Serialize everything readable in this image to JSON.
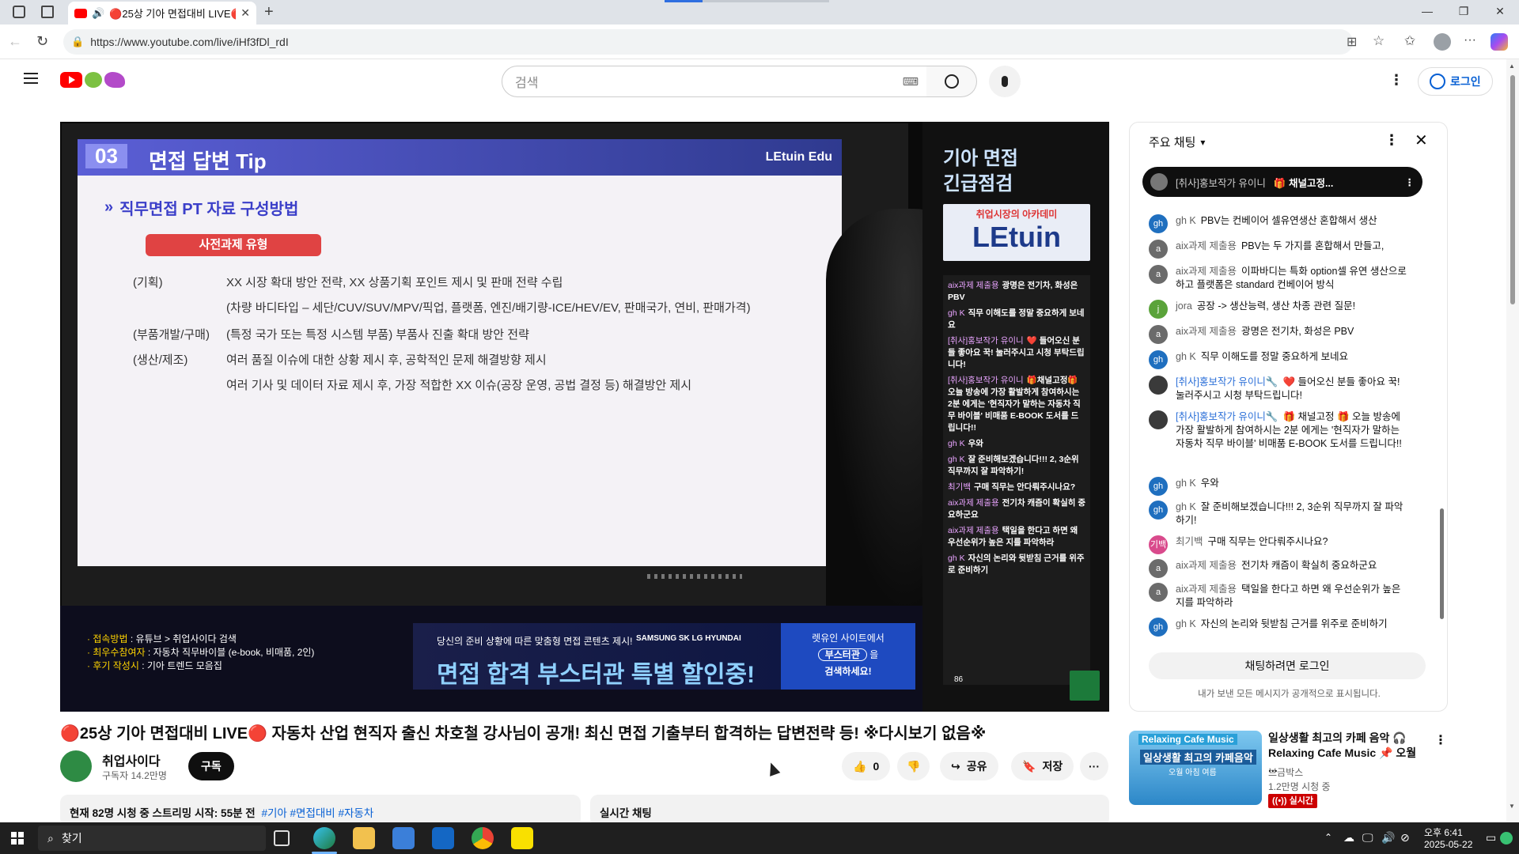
{
  "browser": {
    "tab_title": "🔴25상 기아 면접대비 LIVE🔴",
    "url": "https://www.youtube.com/live/iHf3fDl_rdI"
  },
  "youtube": {
    "search_placeholder": "검색",
    "login_label": "로그인"
  },
  "slide": {
    "section_number": "03",
    "section_title": "면접 답변 Tip",
    "brand": "LEtuin Edu",
    "subtitle": "직무면접 PT 자료 구성방법",
    "badge": "사전과제 유형",
    "rows": [
      {
        "label": "(기획)",
        "text": "XX 시장 확대 방안 전략, XX 상품기획 포인트 제시 및 판매 전략 수립"
      },
      {
        "label": "",
        "text": "(차량 바디타입 – 세단/CUV/SUV/MPV/픽업, 플랫폼, 엔진/배기량-ICE/HEV/EV, 판매국가, 연비, 판매가격)"
      },
      {
        "label": "(부품개발/구매)",
        "text": "(특정 국가 또는 특정 시스템 부품) 부품사 진출 확대 방안 전략"
      },
      {
        "label": "(생산/제조)",
        "text": "여러 품질 이슈에 대한 상황 제시 후, 공학적인 문제 해결방향 제시"
      },
      {
        "label": "",
        "text": "여러 기사 및 데이터 자료 제시 후, 가장 적합한 XX 이슈(공장 운영, 공법 결정 등) 해결방안 제시"
      }
    ]
  },
  "overlay": {
    "side_title_1": "기아 면접",
    "side_title_2": "긴급점검",
    "logo_top": "취업시장의 아카데미",
    "logo_main": "LEtuin",
    "info_lines": [
      {
        "key": "· 접속방법",
        "value": " : 유튜브 > 취업사이다 검색"
      },
      {
        "key": "· 최우수참여자",
        "value": " : 자동차 직무바이블 (e-book, 비매품, 2인)"
      },
      {
        "key": "· 후기 작성시",
        "value": " : 기아 트렌드 모음집"
      }
    ],
    "banner_small": "당신의 준비 상황에 따른 맞춤형 면접 콘텐츠 제시!",
    "banner_brands": "SAMSUNG  SK  LG  HYUNDAI",
    "banner_main": "면접 합격 부스터관 특별 할인중!",
    "banner_right_1": "렛유인 사이트에서",
    "banner_right_2": "부스터관",
    "banner_right_3": "을",
    "banner_right_4": "검색하세요!",
    "mini_chat": [
      {
        "name": "aix과제 제출용",
        "msg": "광명은 전기차, 화성은 PBV"
      },
      {
        "name": "gh K",
        "msg": "직무 이해도를 정말 중요하게 보네요"
      },
      {
        "name": "[취사]홍보작가 유이니",
        "msg": "❤️ 들어오신 분들 좋아요 꾹! 눌러주시고 시청 부탁드립니다!"
      },
      {
        "name": "[취사]홍보작가 유이니",
        "msg": "🎁채널고정🎁 오늘 방송에 가장 활발하게 참여하시는 2분 에게는 '현직자가 말하는 자동차 직무 바이블' 비매품 E-BOOK 도서를 드립니다!!"
      },
      {
        "name": "gh K",
        "msg": "우와"
      },
      {
        "name": "gh K",
        "msg": "잘 준비해보겠습니다!!! 2, 3순위 직무까지 잘 파악하기!"
      },
      {
        "name": "최기백",
        "msg": "구매 직무는 안다뤄주시나요?"
      },
      {
        "name": "aix과제 제출용",
        "msg": "전기차 캐즘이 확실히 중요하군요"
      },
      {
        "name": "aix과제 제출용",
        "msg": "택일을 한다고 하면 왜 우선순위가 높은 지를 파악하라"
      },
      {
        "name": "gh K",
        "msg": "자신의 논리와 뒷받침 근거를 위주로 준비하기"
      }
    ],
    "mini_count": "86"
  },
  "chat": {
    "header": "주요 채팅",
    "pinned_name": "[취사]홍보작가 유이니",
    "pinned_text": "🎁 채널고정...",
    "messages": [
      {
        "av": "gh",
        "color": "#1f6fbf",
        "name": "gh K",
        "owner": false,
        "text": "PBV는 컨베이어 셀유연생산 혼합해서 생산"
      },
      {
        "av": "a",
        "color": "#6b6b6b",
        "name": "aix과제 제출용",
        "owner": false,
        "text": "PBV는 두 가지를 혼합해서 만들고,"
      },
      {
        "av": "a",
        "color": "#6b6b6b",
        "name": "aix과제 제출용",
        "owner": false,
        "text": "이파바디는 특화 option셀 유연 생산으로 하고 플랫폼은 standard 컨베이어 방식"
      },
      {
        "av": "j",
        "color": "#5aa33a",
        "name": "jora",
        "owner": false,
        "text": "공장 -> 생산능력, 생산 차종 관련 질문!"
      },
      {
        "av": "a",
        "color": "#6b6b6b",
        "name": "aix과제 제출용",
        "owner": false,
        "text": "광명은 전기차, 화성은 PBV"
      },
      {
        "av": "gh",
        "color": "#1f6fbf",
        "name": "gh K",
        "owner": false,
        "text": "직무 이해도를 정말 중요하게 보네요"
      },
      {
        "av": "",
        "color": "#3a3a3a",
        "name": "[취사]홍보작가 유이니🔧",
        "owner": true,
        "text": "❤️ 들어오신 분들 좋아요 꾹! 눌러주시고 시청 부탁드립니다!"
      },
      {
        "av": "",
        "color": "#3a3a3a",
        "name": "[취사]홍보작가 유이니🔧",
        "owner": true,
        "text": "🎁 채널고정 🎁 오늘 방송에 가장 활발하게 참여하시는 2분 에게는 '현직자가 말하는 자동차 직무 바이블' 비매품 E-BOOK 도서를 드립니다!!"
      },
      {
        "av": "gh",
        "color": "#1f6fbf",
        "name": "gh K",
        "owner": false,
        "text": "우와"
      },
      {
        "av": "gh",
        "color": "#1f6fbf",
        "name": "gh K",
        "owner": false,
        "text": "잘 준비해보겠습니다!!! 2, 3순위 직무까지 잘 파악하기!"
      },
      {
        "av": "기백",
        "color": "#d94a8c",
        "name": "최기백",
        "owner": false,
        "text": "구매 직무는 안다뤄주시나요?"
      },
      {
        "av": "a",
        "color": "#6b6b6b",
        "name": "aix과제 제출용",
        "owner": false,
        "text": "전기차 캐즘이 확실히 중요하군요"
      },
      {
        "av": "a",
        "color": "#6b6b6b",
        "name": "aix과제 제출용",
        "owner": false,
        "text": "택일을 한다고 하면 왜 우선순위가 높은 지를 파악하라"
      },
      {
        "av": "gh",
        "color": "#1f6fbf",
        "name": "gh K",
        "owner": false,
        "text": "자신의 논리와 뒷받침 근거를 위주로 준비하기"
      }
    ],
    "login_button": "채팅하려면 로그인",
    "footer_note": "내가 보낸 모든 메시지가 공개적으로 표시됩니다."
  },
  "video": {
    "title": "🔴25상 기아 면접대비 LIVE🔴 자동차 산업 현직자 출신 차호철 강사님이 공개! 최신 면접 기출부터 합격하는 답변전략 등! ※다시보기 없음※",
    "channel_name": "취업사이다",
    "subscribers": "구독자 14.2만명",
    "subscribe_label": "구독",
    "like_count": "0",
    "share_label": "공유",
    "save_label": "저장",
    "description": "현재 82명 시청 중  스트리밍 시작: 55분 전",
    "hashtags": "#기아 #면접대비 #자동차",
    "live_chat_label": "실시간 채팅"
  },
  "recommended": {
    "thumb_text_1": "Relaxing Cafe Music",
    "thumb_text_2": "일상생활 최고의 카페음악",
    "thumb_text_3": "오월 아침 여름",
    "title": "일상생활 최고의 카페 음악 🎧 Relaxing Cafe Music 📌 오월 ...",
    "channel": "브금박스",
    "views": "1.2만명 시청 중",
    "live_badge": "실시간"
  },
  "taskbar": {
    "search_label": "찾기",
    "time": "오후 6:41",
    "date": "2025-05-22"
  }
}
